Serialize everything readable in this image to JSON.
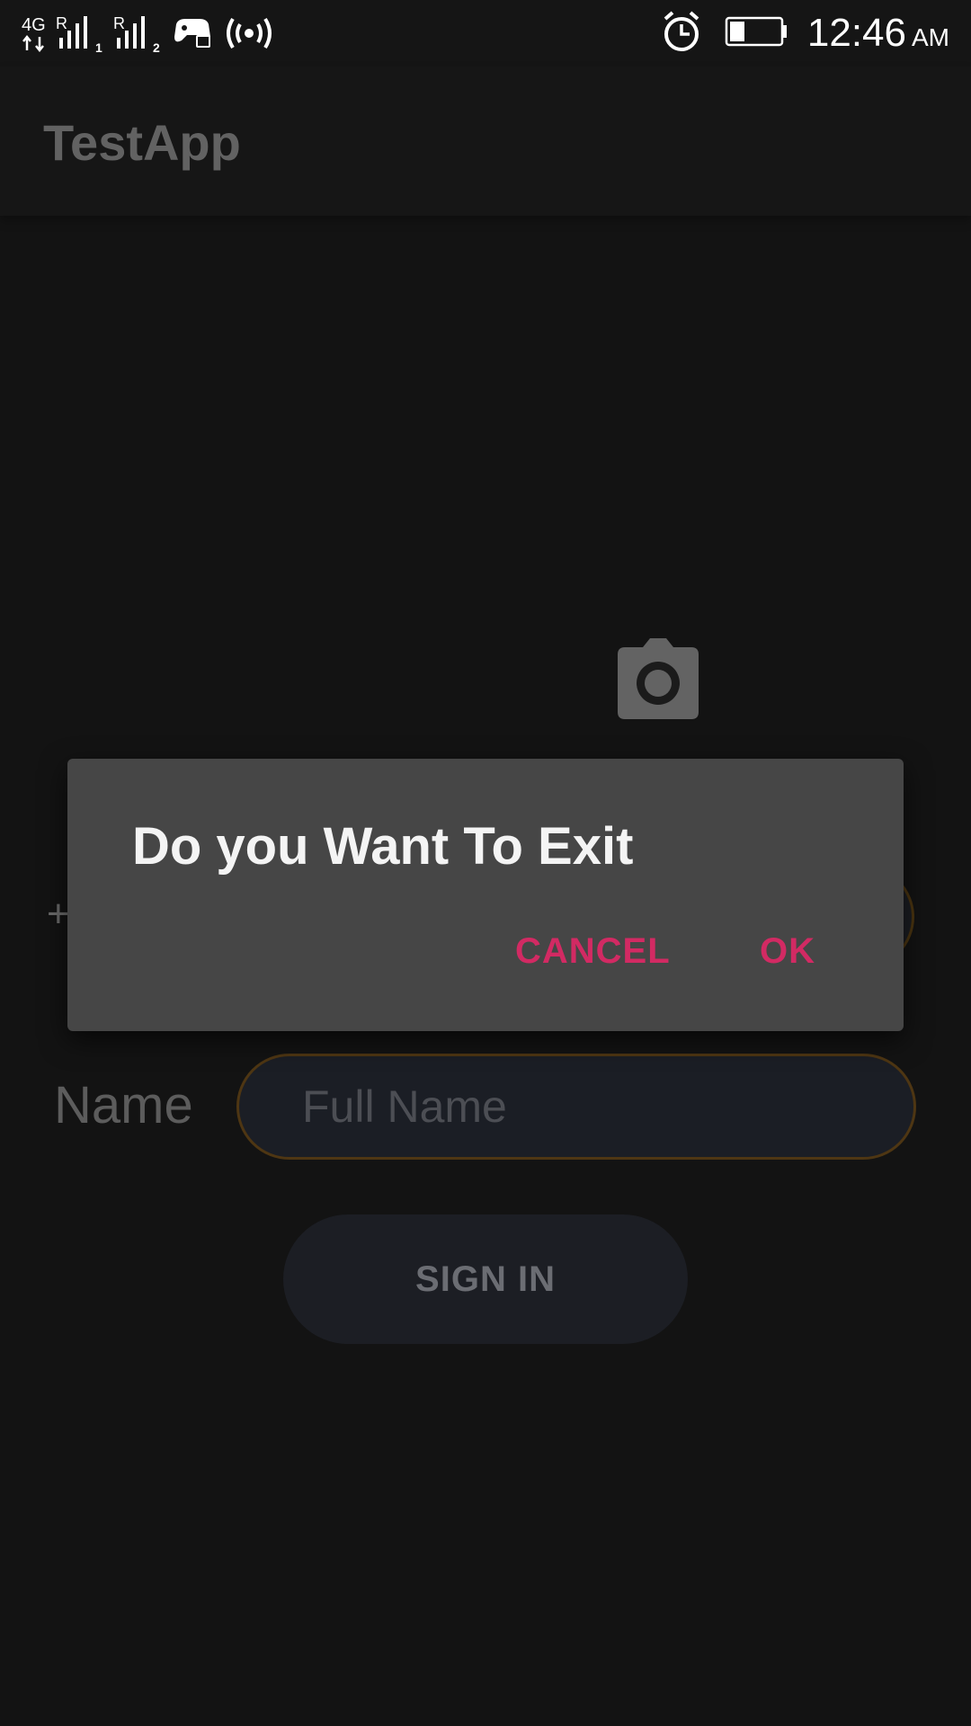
{
  "status_bar": {
    "network_type": "4G",
    "sim1_label": "1",
    "sim2_label": "2",
    "roaming_label": "R",
    "time": "12:46",
    "ampm": "AM",
    "icons": [
      "signal-sim1-icon",
      "signal-sim2-icon",
      "game-controller-icon",
      "hotspot-icon",
      "alarm-icon",
      "battery-icon"
    ]
  },
  "app_bar": {
    "title": "TestApp"
  },
  "form": {
    "camera_icon": "camera-icon",
    "phone_prefix": "+",
    "name_label": "Name",
    "name_placeholder": "Full Name",
    "sign_in_label": "SIGN IN"
  },
  "dialog": {
    "title": "Do you Want To Exit",
    "cancel_label": "CANCEL",
    "ok_label": "OK"
  },
  "colors": {
    "dialog_background": "#464646",
    "dialog_button": "#d22a63",
    "screen_background": "#131313",
    "input_border": "#4e3613"
  }
}
